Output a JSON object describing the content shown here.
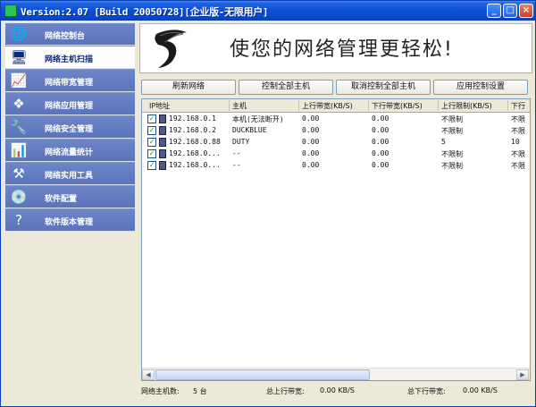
{
  "window": {
    "title": "Version:2.07 [Build 20050728][企业版-无限用户]"
  },
  "sidebar": {
    "items": [
      {
        "label": "网络控制台",
        "icon": "globe-icon",
        "glyph": "🌐"
      },
      {
        "label": "网络主机扫描",
        "icon": "computer-icon",
        "glyph": "🖥"
      },
      {
        "label": "网络带宽管理",
        "icon": "waveform-icon",
        "glyph": "📈"
      },
      {
        "label": "网络应用管理",
        "icon": "windows-icon",
        "glyph": "❖"
      },
      {
        "label": "网络安全管理",
        "icon": "tools-icon",
        "glyph": "🔧"
      },
      {
        "label": "网络流量统计",
        "icon": "chart-icon",
        "glyph": "📊"
      },
      {
        "label": "网络实用工具",
        "icon": "wrench-icon",
        "glyph": "⚒"
      },
      {
        "label": "软件配置",
        "icon": "cd-icon",
        "glyph": "💿"
      },
      {
        "label": "软件版本管理",
        "icon": "help-icon",
        "glyph": "?"
      }
    ],
    "active_index": 1
  },
  "banner": {
    "slogan": "使您的网络管理更轻松!"
  },
  "toolbar": {
    "refresh": "刷新网络",
    "control_all": "控制全部主机",
    "uncontrol_all": "取消控制全部主机",
    "apply": "应用控制设置"
  },
  "table": {
    "columns": [
      "IP地址",
      "主机",
      "上行带宽(KB/S)",
      "下行带宽(KB/S)",
      "上行限制(KB/S)",
      "下行"
    ],
    "rows": [
      {
        "checked": true,
        "ip": "192.168.0.1",
        "host": "本机(无法断开)",
        "up": "0.00",
        "down": "0.00",
        "up_limit": "不限制",
        "down_limit": "不限"
      },
      {
        "checked": true,
        "ip": "192.168.0.2",
        "host": "DUCKBLUE",
        "up": "0.00",
        "down": "0.00",
        "up_limit": "不限制",
        "down_limit": "不限"
      },
      {
        "checked": true,
        "ip": "192.168.0.88",
        "host": "DUTY",
        "up": "0.00",
        "down": "0.00",
        "up_limit": "5",
        "down_limit": "10"
      },
      {
        "checked": true,
        "ip": "192.168.0...",
        "host": "--",
        "up": "0.00",
        "down": "0.00",
        "up_limit": "不限制",
        "down_limit": "不限"
      },
      {
        "checked": true,
        "ip": "192.168.0...",
        "host": "--",
        "up": "0.00",
        "down": "0.00",
        "up_limit": "不限制",
        "down_limit": "不限"
      }
    ]
  },
  "status": {
    "host_count_label": "网络主机数:",
    "host_count": "5 台",
    "total_up_label": "总上行带宽:",
    "total_up": "0.00 KB/S",
    "total_down_label": "总下行带宽:",
    "total_down": "0.00 KB/S"
  },
  "colors": {
    "titlebar": "#0b4fd6",
    "sidebar": "#5b73b9",
    "check": "#21a121"
  }
}
